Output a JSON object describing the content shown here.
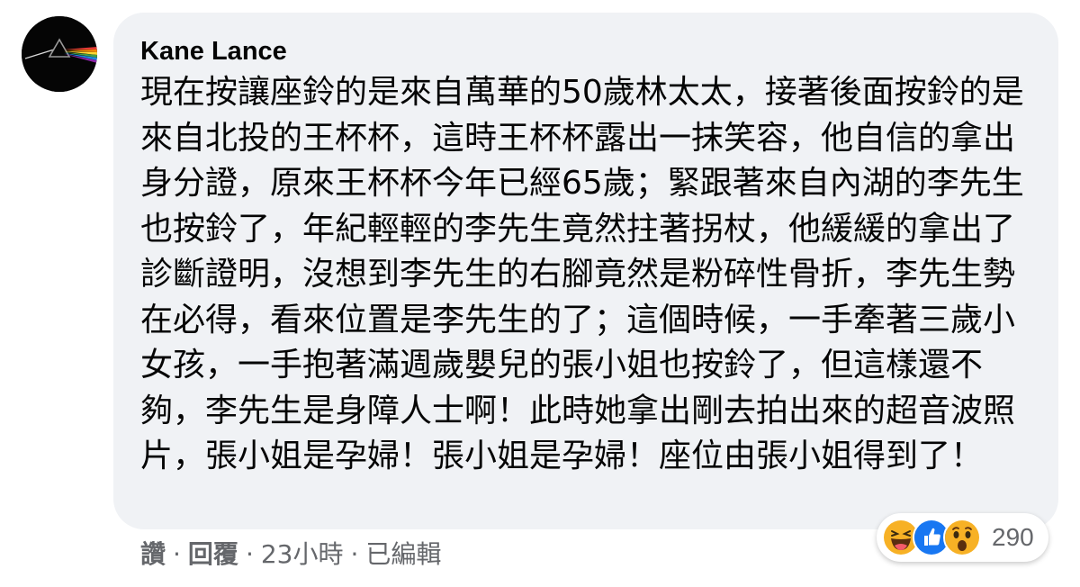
{
  "comment": {
    "author": "Kane Lance",
    "text": "現在按讓座鈴的是來自萬華的50歲林太太，接著後面按鈴的是來自北投的王杯杯，這時王杯杯露出一抹笑容，他自信的拿出身分證，原來王杯杯今年已經65歲；緊跟著來自內湖的李先生也按鈴了，年紀輕輕的李先生竟然拄著拐杖，他緩緩的拿出了診斷證明，沒想到李先生的右腳竟然是粉碎性骨折，李先生勢在必得，看來位置是李先生的了；這個時候，一手牽著三歲小女孩，一手抱著滿週歲嬰兒的張小姐也按鈴了，但這樣還不夠，李先生是身障人士啊！此時她拿出剛去拍出來的超音波照片，張小姐是孕婦！張小姐是孕婦！座位由張小姐得到了！"
  },
  "reactions": {
    "icons": [
      "haha-icon",
      "like-icon",
      "wow-icon"
    ],
    "count": "290"
  },
  "actions": {
    "like": "讚",
    "reply": "回覆",
    "time": "23小時",
    "edited": "已編輯",
    "separator": "·"
  },
  "colors": {
    "bubble": "#f0f2f5",
    "text": "#050505",
    "secondary": "#65676b",
    "like_blue": "#1877f2",
    "reaction_yellow": "#f7b125"
  }
}
